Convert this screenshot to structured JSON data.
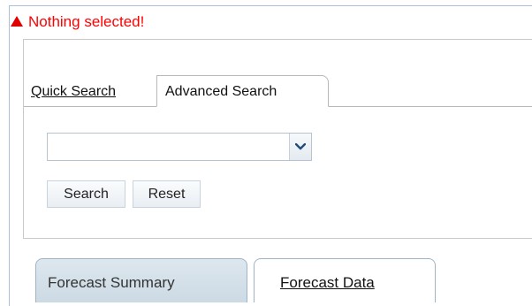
{
  "warning": {
    "text": "Nothing selected!",
    "color": "#ff0000"
  },
  "search_tabs": {
    "quick": "Quick Search",
    "advanced": "Advanced Search"
  },
  "dropdown": {
    "value": ""
  },
  "buttons": {
    "search": "Search",
    "reset": "Reset"
  },
  "bottom_tabs": {
    "summary": "Forecast Summary",
    "data": "Forecast Data"
  },
  "icons": {
    "warning": "warning-triangle-icon",
    "dropdown": "chevron-down-icon"
  },
  "colors": {
    "accent_blue": "#1f4e79",
    "border_blue": "#a9c1d9",
    "tab_active_bg": "#d5e1ea"
  }
}
